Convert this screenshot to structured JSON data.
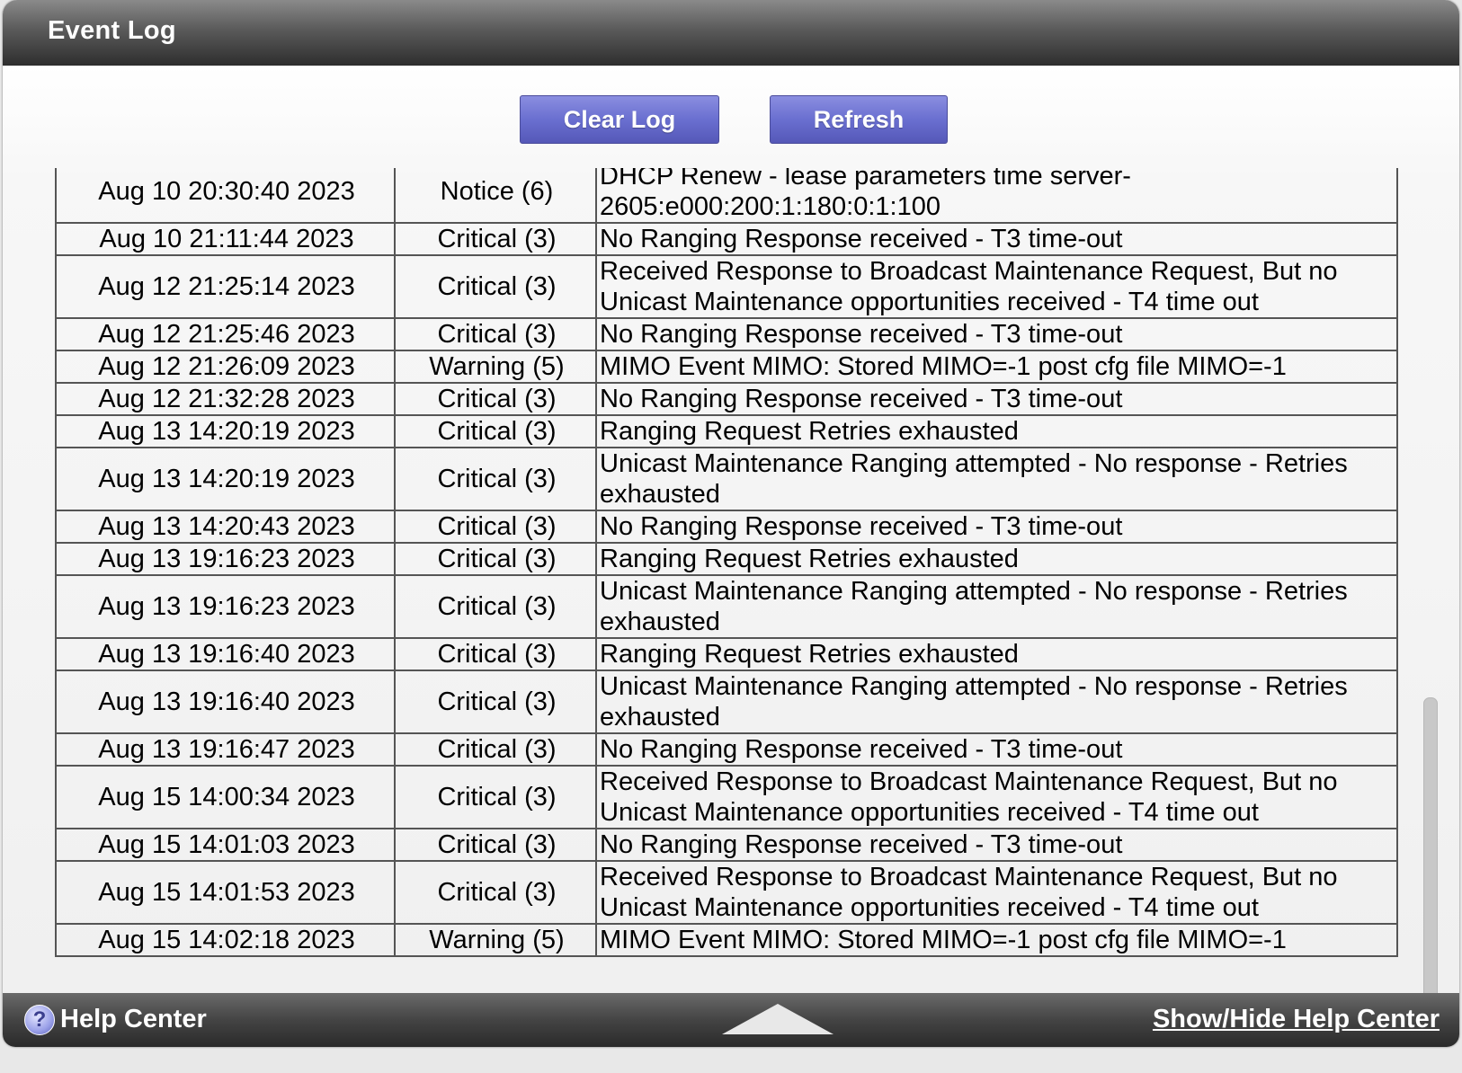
{
  "window": {
    "title": "Event Log"
  },
  "toolbar": {
    "clear_label": "Clear Log",
    "refresh_label": "Refresh"
  },
  "log": {
    "rows": [
      {
        "date": "Aug 10 20:30:40 2023",
        "severity": "Notice (6)",
        "message": "DHCP Renew - lease parameters time server-2605:e000:200:1:180:0:1:100"
      },
      {
        "date": "Aug 10 21:11:44 2023",
        "severity": "Critical (3)",
        "message": "No Ranging Response received - T3 time-out"
      },
      {
        "date": "Aug 12 21:25:14 2023",
        "severity": "Critical (3)",
        "message": "Received Response to Broadcast Maintenance Request, But no Unicast Maintenance opportunities received - T4 time out"
      },
      {
        "date": "Aug 12 21:25:46 2023",
        "severity": "Critical (3)",
        "message": "No Ranging Response received - T3 time-out"
      },
      {
        "date": "Aug 12 21:26:09 2023",
        "severity": "Warning (5)",
        "message": "MIMO Event MIMO: Stored MIMO=-1 post cfg file MIMO=-1"
      },
      {
        "date": "Aug 12 21:32:28 2023",
        "severity": "Critical (3)",
        "message": "No Ranging Response received - T3 time-out"
      },
      {
        "date": "Aug 13 14:20:19 2023",
        "severity": "Critical (3)",
        "message": "Ranging Request Retries exhausted"
      },
      {
        "date": "Aug 13 14:20:19 2023",
        "severity": "Critical (3)",
        "message": "Unicast Maintenance Ranging attempted - No response - Retries exhausted"
      },
      {
        "date": "Aug 13 14:20:43 2023",
        "severity": "Critical (3)",
        "message": "No Ranging Response received - T3 time-out"
      },
      {
        "date": "Aug 13 19:16:23 2023",
        "severity": "Critical (3)",
        "message": "Ranging Request Retries exhausted"
      },
      {
        "date": "Aug 13 19:16:23 2023",
        "severity": "Critical (3)",
        "message": "Unicast Maintenance Ranging attempted - No response - Retries exhausted"
      },
      {
        "date": "Aug 13 19:16:40 2023",
        "severity": "Critical (3)",
        "message": "Ranging Request Retries exhausted"
      },
      {
        "date": "Aug 13 19:16:40 2023",
        "severity": "Critical (3)",
        "message": "Unicast Maintenance Ranging attempted - No response - Retries exhausted"
      },
      {
        "date": "Aug 13 19:16:47 2023",
        "severity": "Critical (3)",
        "message": "No Ranging Response received - T3 time-out"
      },
      {
        "date": "Aug 15 14:00:34 2023",
        "severity": "Critical (3)",
        "message": "Received Response to Broadcast Maintenance Request, But no Unicast Maintenance opportunities received - T4 time out"
      },
      {
        "date": "Aug 15 14:01:03 2023",
        "severity": "Critical (3)",
        "message": "No Ranging Response received - T3 time-out"
      },
      {
        "date": "Aug 15 14:01:53 2023",
        "severity": "Critical (3)",
        "message": "Received Response to Broadcast Maintenance Request, But no Unicast Maintenance opportunities received - T4 time out"
      },
      {
        "date": "Aug 15 14:02:18 2023",
        "severity": "Warning (5)",
        "message": "MIMO Event MIMO: Stored MIMO=-1 post cfg file MIMO=-1"
      }
    ]
  },
  "footer": {
    "help_label": "Help Center",
    "help_icon_glyph": "?",
    "toggle_label": "Show/Hide Help Center"
  },
  "icons": {
    "help": "help-question-icon",
    "expand": "up-arrow-icon"
  }
}
